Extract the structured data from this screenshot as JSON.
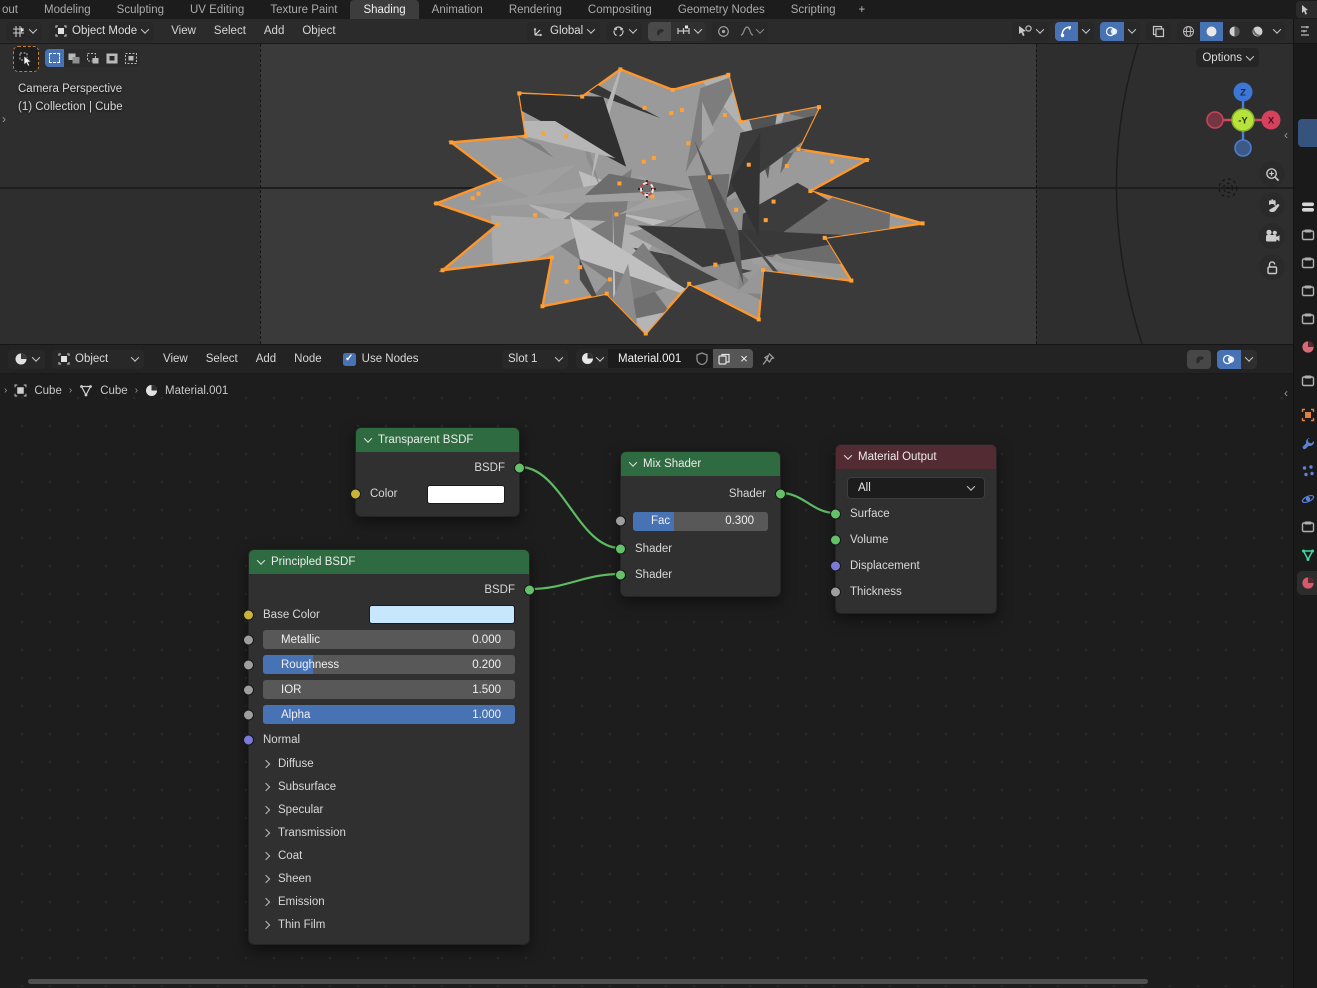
{
  "topbar": {
    "tabs": [
      {
        "label": "out",
        "active": false
      },
      {
        "label": "Modeling",
        "active": false
      },
      {
        "label": "Sculpting",
        "active": false
      },
      {
        "label": "UV Editing",
        "active": false
      },
      {
        "label": "Texture Paint",
        "active": false
      },
      {
        "label": "Shading",
        "active": true
      },
      {
        "label": "Animation",
        "active": false
      },
      {
        "label": "Rendering",
        "active": false
      },
      {
        "label": "Compositing",
        "active": false
      },
      {
        "label": "Geometry Nodes",
        "active": false
      },
      {
        "label": "Scripting",
        "active": false
      }
    ],
    "new_tab_label": "+"
  },
  "viewport_header": {
    "mode_label": "Object Mode",
    "menus": [
      "View",
      "Select",
      "Add",
      "Object"
    ],
    "orientation_label": "Global"
  },
  "viewport": {
    "view_label": "Camera Perspective",
    "context_label": "(1) Collection | Cube",
    "options_label": "Options",
    "gizmo": {
      "top": "Z",
      "right": "X",
      "center": "-Y"
    }
  },
  "shader_header": {
    "mode_label": "Object",
    "menus": [
      "View",
      "Select",
      "Add",
      "Node"
    ],
    "use_nodes_label": "Use Nodes",
    "check_glyph": "✓",
    "slot_label": "Slot 1",
    "material_name": "Material.001",
    "close_glyph": "×"
  },
  "breadcrumb": {
    "items": [
      "Cube",
      "Cube",
      "Material.001"
    ],
    "sep": "›"
  },
  "nodes": {
    "transparent_bsdf": {
      "title": "Transparent BSDF",
      "output_label": "BSDF",
      "color_label": "Color",
      "color_value": "#ffffff"
    },
    "principled_bsdf": {
      "title": "Principled BSDF",
      "output_label": "BSDF",
      "base_color_label": "Base Color",
      "base_color_value": "#c7e7fd",
      "sliders": [
        {
          "label": "Metallic",
          "value": "0.000",
          "fill": 0
        },
        {
          "label": "Roughness",
          "value": "0.200",
          "fill": 0.2
        },
        {
          "label": "IOR",
          "value": "1.500",
          "fill": 0
        },
        {
          "label": "Alpha",
          "value": "1.000",
          "fill": 1
        }
      ],
      "normal_label": "Normal",
      "sections": [
        "Diffuse",
        "Subsurface",
        "Specular",
        "Transmission",
        "Coat",
        "Sheen",
        "Emission",
        "Thin Film"
      ]
    },
    "mix_shader": {
      "title": "Mix Shader",
      "output_label": "Shader",
      "fac_label": "Fac",
      "fac_value": "0.300",
      "fac_fill": 0.3,
      "inputs": [
        "Shader",
        "Shader"
      ]
    },
    "material_output": {
      "title": "Material Output",
      "target_value": "All",
      "inputs": [
        "Surface",
        "Volume",
        "Displacement",
        "Thickness"
      ]
    }
  },
  "colors": {
    "accent_blue": "#4772b3",
    "node_header_green": "#2f6b40",
    "node_header_maroon": "#532b32",
    "wire_green": "#5dbd62",
    "selection_orange": "#ff962b",
    "socket_green": "#65c06a",
    "socket_yellow": "#c9b43a",
    "socket_gray": "#9e9e9e",
    "socket_purple": "#7a7ad8",
    "base_gray": "#9a9a9a"
  },
  "props_tabs": [
    "tool",
    "render",
    "output",
    "view-layer",
    "scene",
    "world",
    "collection",
    "object",
    "modifiers",
    "particles",
    "physics",
    "constraints",
    "data",
    "material"
  ]
}
